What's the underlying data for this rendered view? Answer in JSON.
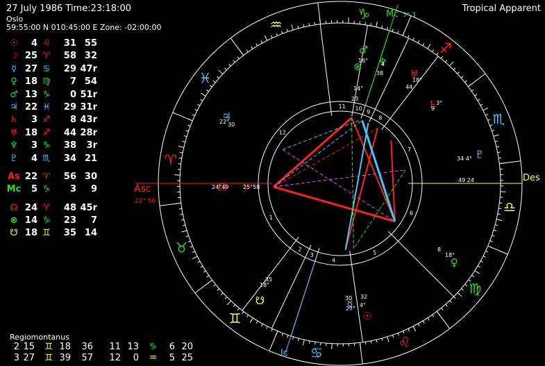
{
  "header": {
    "date_time": "27 July 1986   Time:23:18:00",
    "place": "Oslo",
    "coords": "59:55:00 N 010:45:00 E  Zone: -02:00:00",
    "system": "Tropical Apparent"
  },
  "colors": {
    "fire": "#ff2020",
    "earth": "#20e020",
    "air": "#ffff40",
    "water": "#40c8ff",
    "text": "#ffffff"
  },
  "planets": [
    {
      "glyph": "☉",
      "deg": "4",
      "sign": "♌",
      "min": "31",
      "sec": "55",
      "color": "#ff2020",
      "scolor": "#ff2020"
    },
    {
      "glyph": "☽",
      "deg": "25",
      "sign": "♈",
      "min": "58",
      "sec": "32",
      "color": "#ff2020",
      "scolor": "#ff2020"
    },
    {
      "glyph": "☿",
      "deg": "27",
      "sign": "♋",
      "min": "29",
      "sec": "47r",
      "color": "#40c8ff",
      "scolor": "#40c8ff"
    },
    {
      "glyph": "♀",
      "deg": "18",
      "sign": "♍",
      "min": "7",
      "sec": "54",
      "color": "#20e020",
      "scolor": "#20e020"
    },
    {
      "glyph": "♂",
      "deg": "13",
      "sign": "♑",
      "min": "0",
      "sec": "51r",
      "color": "#20e020",
      "scolor": "#20e020"
    },
    {
      "glyph": "♃",
      "deg": "22",
      "sign": "♓",
      "min": "29",
      "sec": "31r",
      "color": "#40c8ff",
      "scolor": "#40c8ff"
    },
    {
      "glyph": "♄",
      "deg": "3",
      "sign": "♐",
      "min": "8",
      "sec": "43r",
      "color": "#ff2020",
      "scolor": "#ff2020"
    },
    {
      "glyph": "♅",
      "deg": "18",
      "sign": "♐",
      "min": "44",
      "sec": "28r",
      "color": "#ff2020",
      "scolor": "#ff2020"
    },
    {
      "glyph": "♆",
      "deg": "3",
      "sign": "♑",
      "min": "38",
      "sec": "3r",
      "color": "#20e020",
      "scolor": "#20e020"
    },
    {
      "glyph": "♇",
      "deg": "4",
      "sign": "♏",
      "min": "34",
      "sec": "21",
      "color": "#40c8ff",
      "scolor": "#40c8ff"
    }
  ],
  "angles": [
    {
      "glyph": "As",
      "deg": "22",
      "sign": "♈",
      "min": "56",
      "sec": "30",
      "color": "#ff2020",
      "scolor": "#ff2020"
    },
    {
      "glyph": "Mc",
      "deg": "5",
      "sign": "♑",
      "min": "3",
      "sec": "9",
      "color": "#20e020",
      "scolor": "#20e020"
    }
  ],
  "points": [
    {
      "glyph": "☊",
      "deg": "24",
      "sign": "♈",
      "min": "48",
      "sec": "45r",
      "color": "#ff2020",
      "scolor": "#ff2020"
    },
    {
      "glyph": "⊗",
      "deg": "14",
      "sign": "♑",
      "min": "23",
      "sec": "7",
      "color": "#20e020",
      "scolor": "#20e020"
    },
    {
      "glyph": "☋",
      "deg": "18",
      "sign": "♊",
      "min": "35",
      "sec": "14",
      "color": "#ffff40",
      "scolor": "#ffff40"
    }
  ],
  "regio": {
    "title": "Regiomontanus",
    "rows": [
      {
        "h": "2",
        "d": "15",
        "s": "♊",
        "m": "18",
        "sec": "36",
        "h2": "11",
        "d2": "13",
        "s2": "♑",
        "m2": "6",
        "sec2": "20",
        "sc": "#ffff40",
        "sc2": "#20e020"
      },
      {
        "h": "3",
        "d": "27",
        "s": "♊",
        "m": "39",
        "sec": "57",
        "h2": "12",
        "d2": "0",
        "s2": "♒",
        "m2": "5",
        "sec2": "25",
        "sc": "#ffff40",
        "sc2": "#ffff40"
      }
    ]
  },
  "wheel": {
    "zodiac": [
      {
        "glyph": "♒",
        "color": "#ffff40"
      },
      {
        "glyph": "♑",
        "color": "#20e020"
      },
      {
        "glyph": "♐",
        "color": "#ff2020"
      },
      {
        "glyph": "♏",
        "color": "#40c8ff"
      },
      {
        "glyph": "♎",
        "color": "#ffff40"
      },
      {
        "glyph": "♍",
        "color": "#20e020"
      },
      {
        "glyph": "♌",
        "color": "#ff2020"
      },
      {
        "glyph": "♋",
        "color": "#40c8ff"
      },
      {
        "glyph": "♊",
        "color": "#ffff40"
      },
      {
        "glyph": "♉",
        "color": "#20e020"
      },
      {
        "glyph": "♈",
        "color": "#ff2020"
      },
      {
        "glyph": "♓",
        "color": "#40c8ff"
      }
    ],
    "houses": [
      "1",
      "2",
      "3",
      "4",
      "5",
      "6",
      "7",
      "8",
      "9",
      "10",
      "11",
      "12"
    ],
    "asc_label": "Asc",
    "asc_deg": "22",
    "asc_min": "56",
    "desc_label": "Des",
    "mc_label": "Mc",
    "mc_deg": "5",
    "mc_min": "3",
    "ic_label": "Ic",
    "desc_deg": "49 24",
    "labels": [
      {
        "text": "24°49",
        "color": "#ffffff"
      },
      {
        "text": "25°58",
        "color": "#ffffff"
      },
      {
        "text": "16°",
        "color": "#ffffff"
      },
      {
        "text": "4",
        "color": "#ffffff"
      },
      {
        "text": "38",
        "color": "#ffffff"
      },
      {
        "text": "14°",
        "color": "#ffffff"
      },
      {
        "text": "23",
        "color": "#ffffff"
      },
      {
        "text": "18°",
        "color": "#ffffff"
      },
      {
        "text": "44",
        "color": "#ffffff"
      },
      {
        "text": "9",
        "color": "#ffffff"
      },
      {
        "text": "3°",
        "color": "#ffffff"
      },
      {
        "text": "22°",
        "color": "#ffffff"
      },
      {
        "text": "30",
        "color": "#ffffff"
      },
      {
        "text": "34 4°",
        "color": "#ffffff"
      },
      {
        "text": "8",
        "color": "#ffffff"
      },
      {
        "text": "18°",
        "color": "#ffffff"
      },
      {
        "text": "35",
        "color": "#ffffff"
      },
      {
        "text": "18°",
        "color": "#ffffff"
      },
      {
        "text": "30",
        "color": "#ffffff"
      },
      {
        "text": "27°",
        "color": "#ffffff"
      },
      {
        "text": "32",
        "color": "#ffffff"
      },
      {
        "text": "4°",
        "color": "#ffffff"
      }
    ]
  }
}
